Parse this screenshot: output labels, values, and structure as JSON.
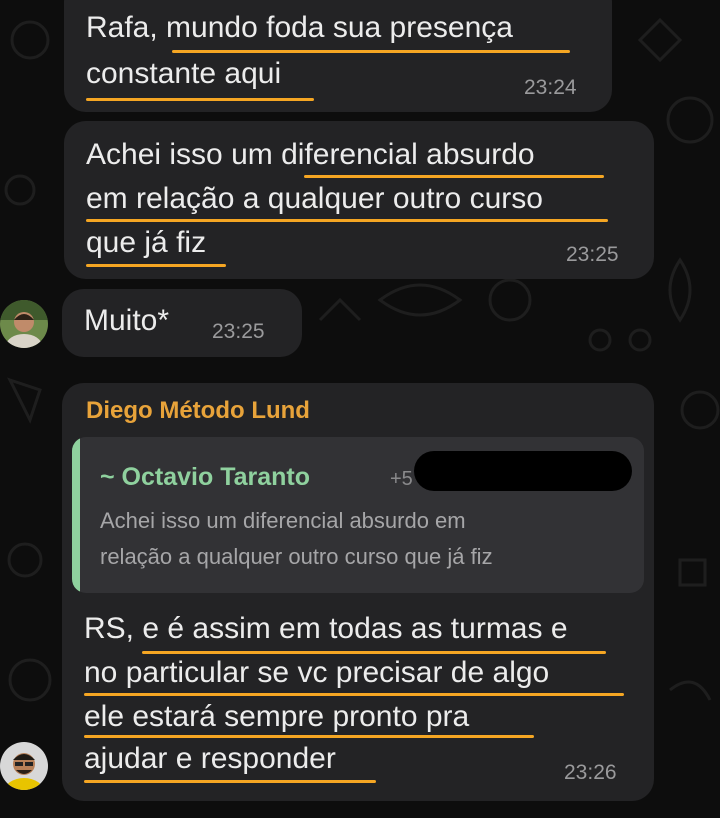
{
  "colors": {
    "background": "#0d0d0d",
    "bubble": "#232325",
    "underline": "#f5a623",
    "sender_name": "#e8a33a",
    "quote_author": "#8fd19e",
    "timestamp": "#9a9a9c"
  },
  "messages": [
    {
      "lines": [
        "Rafa, mundo foda sua presença",
        "constante aqui"
      ],
      "time": "23:24"
    },
    {
      "lines": [
        "Achei isso um diferencial absurdo",
        "em relação a qualquer outro curso",
        "que já fiz"
      ],
      "time": "23:25"
    },
    {
      "lines": [
        "Muito*"
      ],
      "time": "23:25",
      "avatar": "user-avatar"
    },
    {
      "sender": "Diego Método Lund",
      "quote": {
        "author": "~ Octavio Taranto",
        "phone": "+5",
        "lines": [
          "Achei isso um diferencial absurdo em",
          "relação a qualquer outro curso que já fiz"
        ]
      },
      "lines": [
        "RS, e é assim em todas as turmas e",
        "no particular se vc precisar de algo",
        "ele estará sempre pronto pra",
        "ajudar e responder"
      ],
      "time": "23:26",
      "avatar": "diego-avatar"
    }
  ]
}
